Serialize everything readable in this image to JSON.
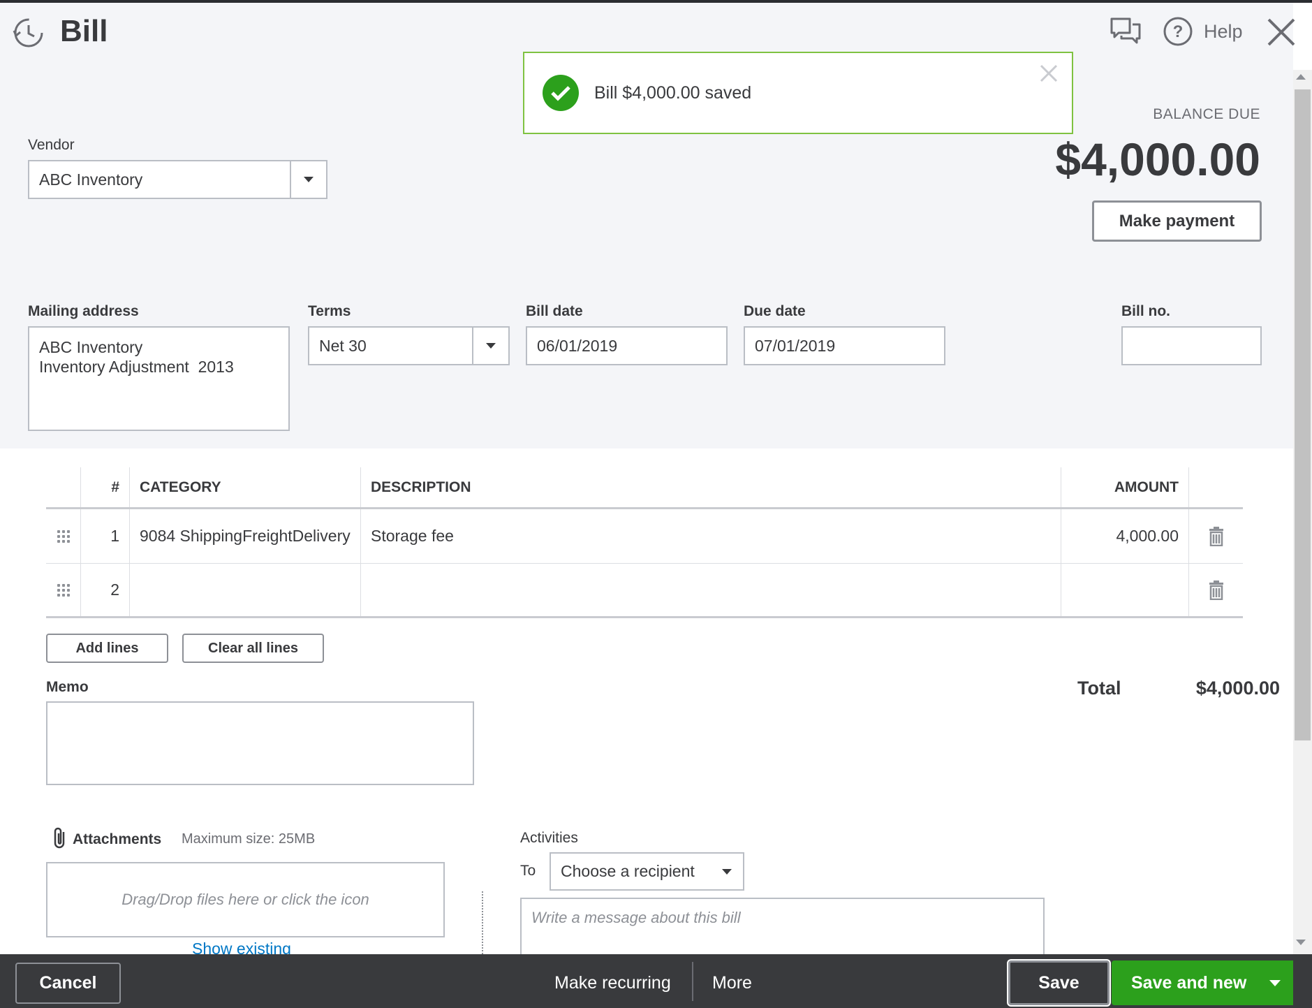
{
  "header": {
    "title": "Bill",
    "help_label": "Help"
  },
  "toast": {
    "message": "Bill $4,000.00 saved"
  },
  "balance": {
    "label": "BALANCE DUE",
    "amount": "$4,000.00",
    "make_payment_label": "Make payment"
  },
  "vendor": {
    "label": "Vendor",
    "value": "ABC Inventory"
  },
  "mailing": {
    "label": "Mailing address",
    "line1": "ABC Inventory",
    "line2": "Inventory Adjustment  2013"
  },
  "terms": {
    "label": "Terms",
    "value": "Net 30"
  },
  "bill_date": {
    "label": "Bill date",
    "value": "06/01/2019"
  },
  "due_date": {
    "label": "Due date",
    "value": "07/01/2019"
  },
  "bill_no": {
    "label": "Bill no.",
    "value": ""
  },
  "table": {
    "headers": {
      "num": "#",
      "category": "CATEGORY",
      "description": "DESCRIPTION",
      "amount": "AMOUNT"
    },
    "rows": [
      {
        "num": "1",
        "category": "9084 ShippingFreightDelivery",
        "description": "Storage fee",
        "amount": "4,000.00"
      },
      {
        "num": "2",
        "category": "",
        "description": "",
        "amount": ""
      }
    ]
  },
  "actions": {
    "add_lines": "Add lines",
    "clear_all_lines": "Clear all lines"
  },
  "memo": {
    "label": "Memo",
    "value": ""
  },
  "total": {
    "label": "Total",
    "value": "$4,000.00"
  },
  "attachments": {
    "label": "Attachments",
    "max_size": "Maximum size: 25MB",
    "dropzone": "Drag/Drop files here or click the icon",
    "show_existing": "Show existing"
  },
  "activities": {
    "label": "Activities",
    "to_label": "To",
    "recipient_placeholder": "Choose a recipient",
    "message_placeholder": "Write a message about this bill"
  },
  "footer": {
    "cancel": "Cancel",
    "make_recurring": "Make recurring",
    "more": "More",
    "save": "Save",
    "save_and_new": "Save and new"
  },
  "colors": {
    "accent_green": "#2ca01c",
    "toast_border": "#7fc241",
    "footer_bg": "#393a3d",
    "link_blue": "#0077c5"
  },
  "icons": {
    "history": "history-clock-icon",
    "feedback": "chat-bubbles-icon",
    "help": "question-circle-icon",
    "close": "close-icon",
    "toast_check": "check-circle-icon",
    "delete_row": "trash-icon",
    "drag": "drag-handle-icon",
    "attach": "paperclip-icon"
  }
}
